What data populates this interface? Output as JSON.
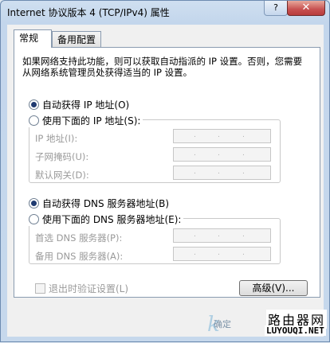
{
  "window": {
    "title": "Internet 协议版本 4 (TCP/IPv4) 属性",
    "help_label": "?",
    "close_label": "✕"
  },
  "tabs": [
    {
      "label": "常规",
      "active": true
    },
    {
      "label": "备用配置",
      "active": false
    }
  ],
  "description": "如果网络支持此功能，则可以获取自动指派的 IP 设置。否则，您需要从网络系统管理员处获得适当的 IP 设置。",
  "ip": {
    "auto_label": "自动获得 IP 地址(O)",
    "auto_checked": true,
    "manual_label": "使用下面的 IP 地址(S):",
    "manual_checked": false,
    "fields": [
      {
        "label": "IP 地址(I):",
        "value": ". . ."
      },
      {
        "label": "子网掩码(U):",
        "value": ". . ."
      },
      {
        "label": "默认网关(D):",
        "value": ". . ."
      }
    ]
  },
  "dns": {
    "auto_label": "自动获得 DNS 服务器地址(B)",
    "auto_checked": true,
    "manual_label": "使用下面的 DNS 服务器地址(E):",
    "manual_checked": false,
    "fields": [
      {
        "label": "首选 DNS 服务器(P):",
        "value": ". . ."
      },
      {
        "label": "备用 DNS 服务器(A):",
        "value": ". . ."
      }
    ]
  },
  "validate_label": "退出时验证设置(L)",
  "advanced_label": "高级(V)...",
  "ok_label": "确定",
  "watermark": {
    "cn": "路由器网",
    "en": "LUYOUQI.NET",
    "k": "k"
  }
}
